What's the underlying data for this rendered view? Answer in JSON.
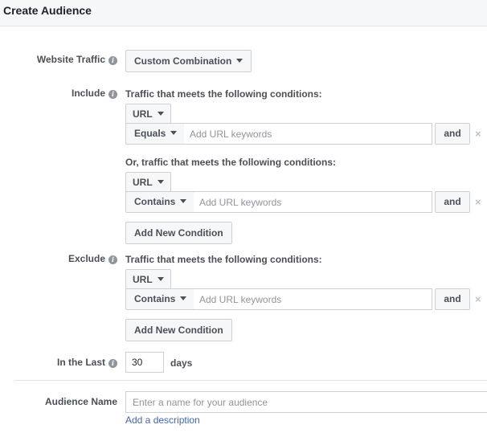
{
  "header": {
    "title": "Create Audience"
  },
  "website_traffic": {
    "label": "Website Traffic",
    "dropdown": "Custom Combination"
  },
  "include": {
    "label": "Include",
    "groups": [
      {
        "heading": "Traffic that meets the following conditions:",
        "field": "URL",
        "operator": "Equals",
        "placeholder": "Add URL keywords",
        "and_label": "and"
      },
      {
        "heading": "Or, traffic that meets the following conditions:",
        "field": "URL",
        "operator": "Contains",
        "placeholder": "Add URL keywords",
        "and_label": "and"
      }
    ],
    "add_condition": "Add New Condition"
  },
  "exclude": {
    "label": "Exclude",
    "heading": "Traffic that meets the following conditions:",
    "field": "URL",
    "operator": "Contains",
    "placeholder": "Add URL keywords",
    "and_label": "and",
    "add_condition": "Add New Condition"
  },
  "in_the_last": {
    "label": "In the Last",
    "value": "30",
    "unit": "days"
  },
  "audience_name": {
    "label": "Audience Name",
    "placeholder": "Enter a name for your audience",
    "add_description": "Add a description"
  },
  "icons": {
    "info": "info-icon",
    "remove": "close-icon",
    "dropdown": "chevron-down-icon"
  },
  "colors": {
    "link": "#4267b2",
    "border": "#ced0d4",
    "button_bg": "#f6f7f9"
  }
}
